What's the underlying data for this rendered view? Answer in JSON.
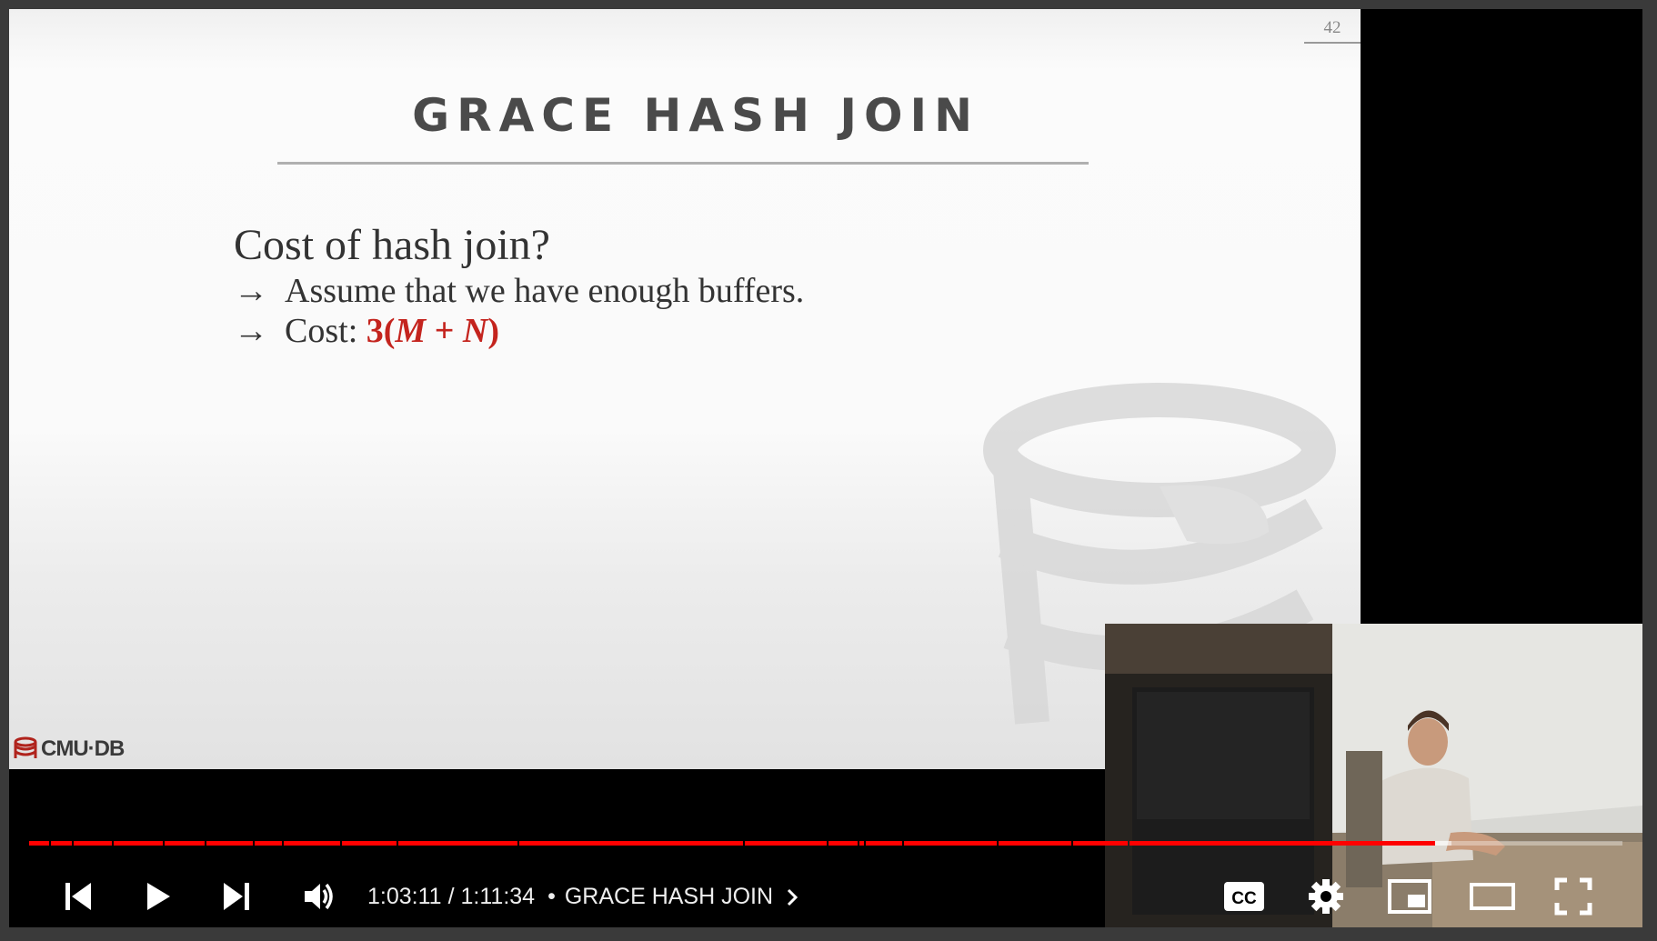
{
  "slide": {
    "number": "42",
    "title": "GRACE HASH JOIN",
    "heading": "Cost of hash join?",
    "bullets": {
      "arrow": "→",
      "first": "Assume that we have enough buffers.",
      "second_label": "Cost:",
      "formula_prefix": "3(",
      "formula_m": "M",
      "formula_plus": " + ",
      "formula_n": "N",
      "formula_suffix": ")"
    },
    "logo_text": "CMU·DB",
    "accent_color": "#c4241e"
  },
  "player": {
    "current_time": "1:03:11",
    "separator": "/",
    "duration": "1:11:34",
    "chapter_separator": "•",
    "chapter": "GRACE HASH JOIN",
    "progress_fraction": 0.8827,
    "buffered_fraction": 0.8925,
    "progress_color": "#ff0000",
    "icons": {
      "previous": "skip-previous-icon",
      "play": "play-icon",
      "next": "skip-next-icon",
      "volume": "volume-icon",
      "chapter": "chevron-right-icon",
      "captions": "closed-captions-icon",
      "settings": "gear-icon",
      "miniplayer": "miniplayer-icon",
      "theater": "theater-mode-icon",
      "fullscreen": "fullscreen-icon"
    }
  }
}
